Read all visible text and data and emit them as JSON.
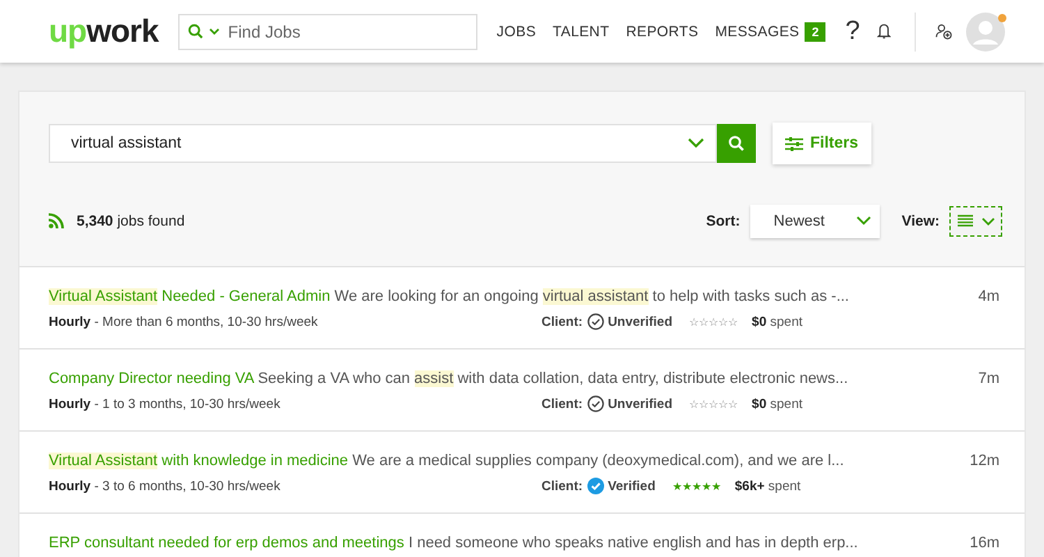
{
  "header": {
    "logo": [
      "up",
      "work"
    ],
    "search": {
      "placeholder": "Find Jobs"
    },
    "nav": [
      "JOBS",
      "TALENT",
      "REPORTS",
      "MESSAGES"
    ],
    "messages_badge": "2",
    "help": "?",
    "avatar_notification": true
  },
  "search_bar": {
    "query": "virtual assistant",
    "filters_button": "Filters"
  },
  "results": {
    "count": "**5,340** jobs found",
    "sort_label": "Sort:",
    "sort_value": "Newest",
    "view_label": "View:",
    "view_toggle_focused": true
  },
  "jobs": [
    {
      "title": [
        {
          "text": "Virtual Assistant",
          "highlighted": true
        },
        {
          "text": " Needed - General Admin",
          "highlighted": false
        }
      ],
      "description": [
        {
          "text": "We are looking for an ongoing ",
          "highlighted": false
        },
        {
          "text": "virtual assistant",
          "highlighted": true
        },
        {
          "text": " to help with tasks such as -...",
          "highlighted": false
        }
      ],
      "time": "4m",
      "meta": "**Hourly** - More than 6 months, 10-30 hrs/week",
      "client_label": "Client:",
      "verified": false,
      "verification": "Unverified",
      "stars": 0,
      "spent": "**$0** spent"
    },
    {
      "title": [
        {
          "text": "Company Director needing VA",
          "highlighted": false
        }
      ],
      "description": [
        {
          "text": "Seeking a VA who can ",
          "highlighted": false
        },
        {
          "text": "assist",
          "highlighted": true
        },
        {
          "text": " with data collation, data entry, distribute electronic news...",
          "highlighted": false
        }
      ],
      "time": "7m",
      "meta": "**Hourly** - 1 to 3 months, 10-30 hrs/week",
      "client_label": "Client:",
      "verified": false,
      "verification": "Unverified",
      "stars": 0,
      "spent": "**$0** spent"
    },
    {
      "title": [
        {
          "text": "Virtual Assistant",
          "highlighted": true
        },
        {
          "text": " with knowledge in medicine",
          "highlighted": false
        }
      ],
      "description": [
        {
          "text": "We are a medical supplies company (deoxymedical.com), and we are l...",
          "highlighted": false
        }
      ],
      "time": "12m",
      "meta": "**Hourly** - 3 to 6 months, 10-30 hrs/week",
      "client_label": "Client:",
      "verified": true,
      "verification": "Verified",
      "stars": 5,
      "spent": "**$6k+** spent"
    },
    {
      "title": [
        {
          "text": "ERP consultant needed for erp demos and meetings",
          "highlighted": false
        }
      ],
      "description": [
        {
          "text": "I need someone who speaks native english and has in depth erp...",
          "highlighted": false
        }
      ],
      "time": "16m"
    }
  ]
}
